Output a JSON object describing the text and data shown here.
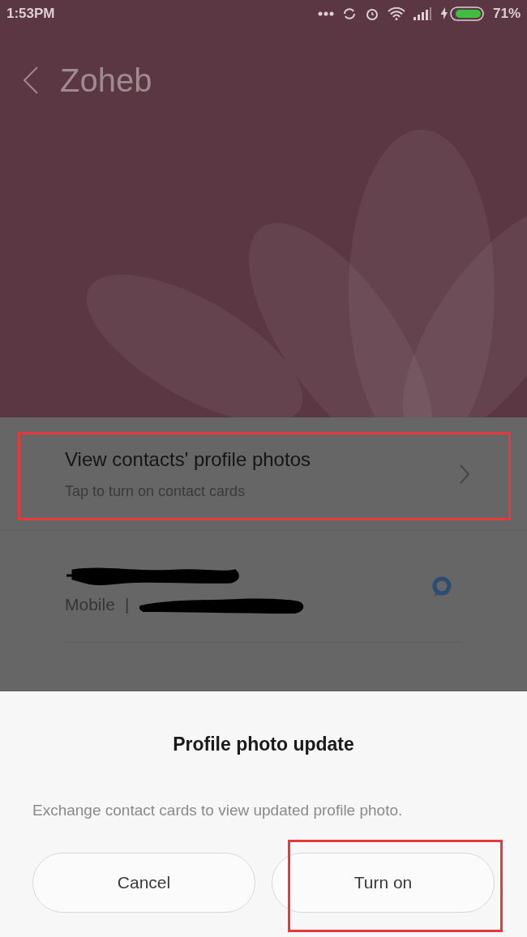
{
  "status_bar": {
    "time": "1:53PM",
    "battery": "71%"
  },
  "header": {
    "title": "Zoheb"
  },
  "profile_photos_row": {
    "title": "View contacts' profile photos",
    "subtitle": "Tap to turn on contact cards",
    "highlighted": true
  },
  "contact": {
    "label": "Mobile",
    "separator": "|"
  },
  "dialog": {
    "title": "Profile photo update",
    "message": "Exchange contact cards to view updated profile photo.",
    "buttons": [
      {
        "label": "Cancel",
        "highlighted": false
      },
      {
        "label": "Turn on",
        "highlighted": true
      }
    ]
  }
}
